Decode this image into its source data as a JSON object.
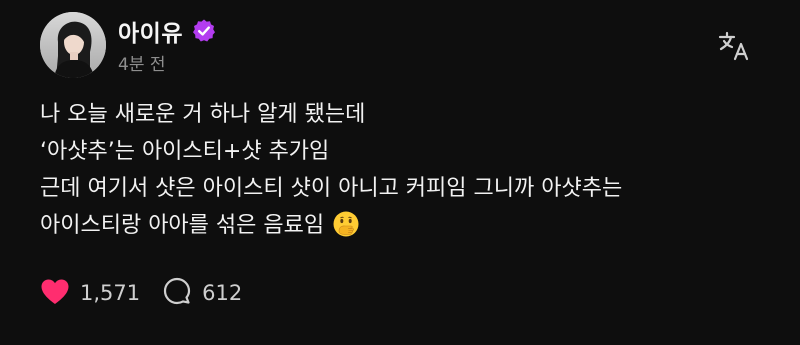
{
  "post": {
    "author": {
      "name": "아이유",
      "verified": true
    },
    "timestamp": "4분 전",
    "content": {
      "lines": [
        "나 오늘 새로운 거 하나 알게 됐는데",
        "‘아샷추’는 아이스티+샷 추가임",
        "근데 여기서 샷은 아이스티 샷이 아니고 커피임 그니까 아샷추는",
        "아이스티랑 아아를 섞은 음료임"
      ],
      "emoji": "face-with-hand-over-mouth"
    },
    "actions": {
      "likes": "1,571",
      "comments": "612"
    },
    "icons": {
      "verified": "verified-badge-icon",
      "translate": "translate-icon",
      "like": "heart-icon",
      "comment": "comment-icon"
    },
    "colors": {
      "background": "#0e0e0e",
      "verified_badge": "#b33cf0",
      "like": "#ff2d6f",
      "muted_text": "#8e8e8e"
    }
  }
}
